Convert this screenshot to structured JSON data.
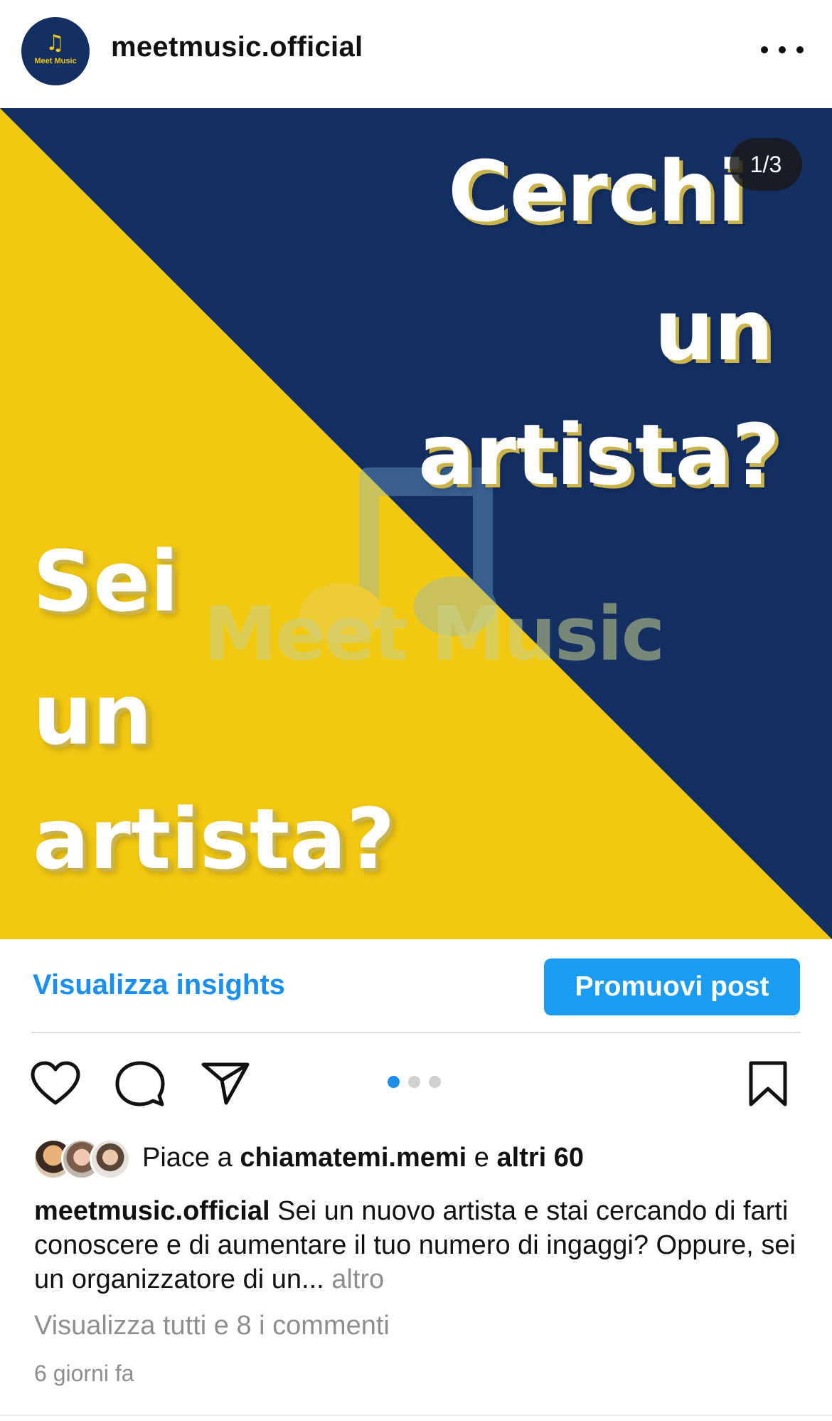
{
  "header": {
    "avatar_note": "♫",
    "avatar_text": "Meet Music",
    "username": "meetmusic.official",
    "more_icon": "more-horizontal-icon"
  },
  "post": {
    "counter": "1/3",
    "text_top": [
      "Cerchi",
      "un",
      "artista?"
    ],
    "text_bottom": [
      "Sei",
      "un",
      "artista?"
    ],
    "watermark": "Meet Music",
    "colors": {
      "blue": "#143063",
      "yellow": "#f2c811"
    }
  },
  "insights": {
    "link_label": "Visualizza insights",
    "promote_label": "Promuovi post"
  },
  "actions": {
    "icons": [
      "heart-icon",
      "comment-icon",
      "send-icon",
      "bookmark-icon"
    ],
    "carousel_pages": 3,
    "carousel_active": 1
  },
  "likes": {
    "prefix": "Piace a",
    "user": "chiamatemi.memi",
    "joiner": "e",
    "others": "altri 60"
  },
  "caption": {
    "username": "meetmusic.official",
    "text": "Sei un nuovo artista e stai cercando di farti conoscere e di aumentare il tuo numero di ingaggi? Oppure, sei un organizzatore di un...",
    "more": "altro"
  },
  "comments": {
    "label": "Visualizza tutti e 8 i commenti"
  },
  "timestamp": "6 giorni fa"
}
